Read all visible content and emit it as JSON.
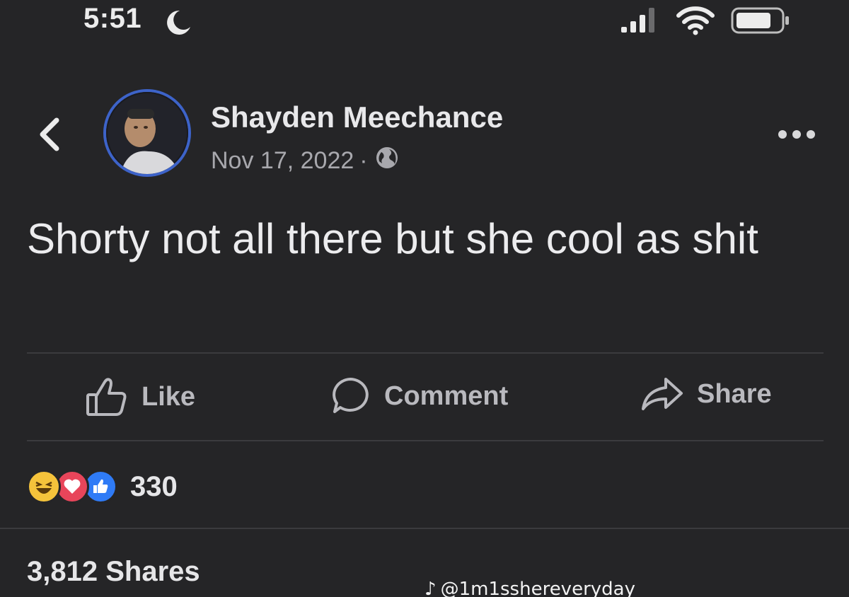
{
  "status_bar": {
    "time": "5:51"
  },
  "post": {
    "author": "Shayden Meechance",
    "date": "Nov 17, 2022",
    "separator": "·",
    "text": "Shorty not all there but she cool as shit"
  },
  "actions": {
    "like_label": "Like",
    "comment_label": "Comment",
    "share_label": "Share"
  },
  "reactions": {
    "count": "330",
    "types": [
      "haha",
      "love",
      "like"
    ]
  },
  "shares": {
    "label": "3,812 Shares"
  },
  "watermark": {
    "handle": "@1m1sshereveryday"
  },
  "colors": {
    "background": "#252527",
    "avatar_ring": "#3d63c9",
    "haha": "#f5c33b",
    "love": "#e8455a",
    "like": "#2f7bf6"
  }
}
